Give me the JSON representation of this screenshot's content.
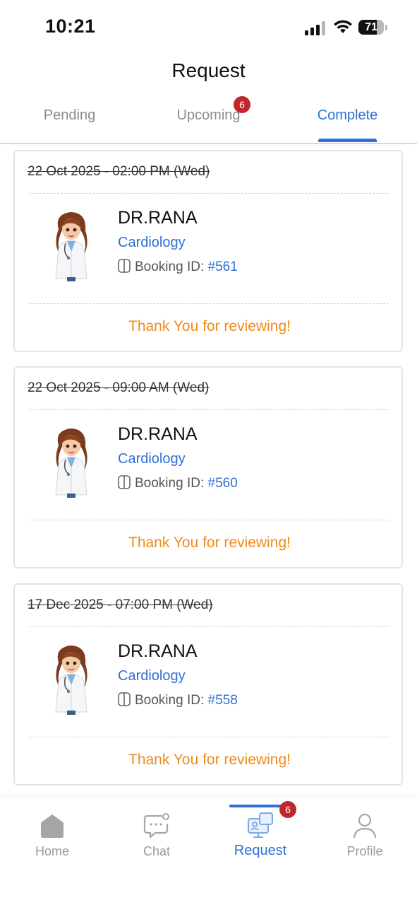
{
  "status_bar": {
    "time": "10:21",
    "battery": "71",
    "battery_level": 0.71
  },
  "header": {
    "title": "Request"
  },
  "tabs": [
    {
      "label": "Pending",
      "active": false
    },
    {
      "label": "Upcoming",
      "active": false,
      "badge": "6"
    },
    {
      "label": "Complete",
      "active": true
    }
  ],
  "requests": [
    {
      "date": "22 Oct 2025 - 02:00 PM (Wed)",
      "doctor": "DR.RANA",
      "specialty": "Cardiology",
      "booking_label": "Booking ID:",
      "booking_id": "#561",
      "footer": "Thank You for reviewing!"
    },
    {
      "date": "22 Oct 2025 - 09:00 AM (Wed)",
      "doctor": "DR.RANA",
      "specialty": "Cardiology",
      "booking_label": "Booking ID:",
      "booking_id": "#560",
      "footer": "Thank You for reviewing!"
    },
    {
      "date": "17 Dec 2025 - 07:00 PM (Wed)",
      "doctor": "DR.RANA",
      "specialty": "Cardiology",
      "booking_label": "Booking ID:",
      "booking_id": "#558",
      "footer": "Thank You for reviewing!"
    }
  ],
  "bottom_nav": {
    "items": [
      {
        "label": "Home",
        "icon": "home-icon"
      },
      {
        "label": "Chat",
        "icon": "chat-icon"
      },
      {
        "label": "Request",
        "icon": "request-icon",
        "active": true,
        "badge": "6"
      },
      {
        "label": "Profile",
        "icon": "profile-icon"
      }
    ]
  },
  "colors": {
    "accent": "#2f6fd6",
    "badge": "#c0272d",
    "thanks": "#f08a1c"
  }
}
